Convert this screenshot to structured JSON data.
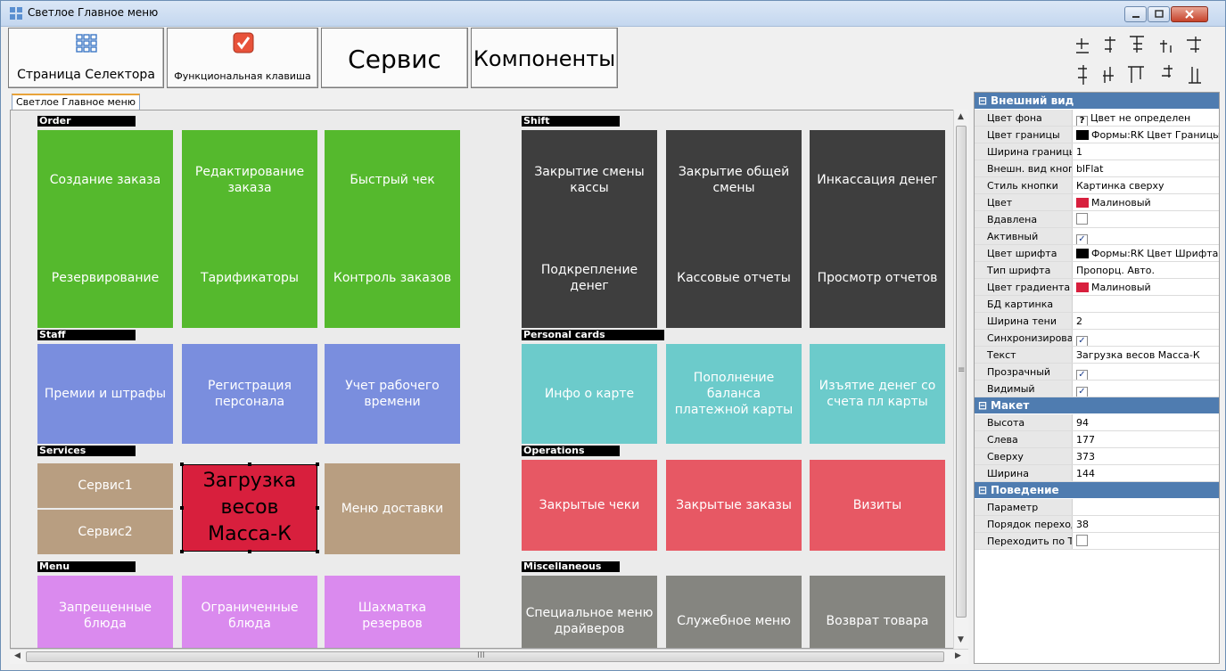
{
  "window": {
    "title": "Светлое Главное меню"
  },
  "toolbar": {
    "selector_page": "Страница Селектора",
    "function_key": "Функциональная клавиша",
    "service": "Сервис",
    "components": "Компоненты"
  },
  "align_tools": [
    "⊣ ⫞ ⊐ ⊥ ⊢",
    "⊤ ⫟ ⊏ ⊣ ⊥"
  ],
  "tab": {
    "label": "Светлое Главное меню"
  },
  "colors": {
    "green": "#55b92d",
    "dark": "#3e3e3e",
    "blue": "#7a8ede",
    "cyan": "#6ccbcb",
    "tan": "#b89e81",
    "crimson": "#d81f3d",
    "coral": "#e75864",
    "violet": "#da8aee",
    "gray": "#858580"
  },
  "groups": {
    "order": "Order",
    "shift": "Shift",
    "staff": "Staff",
    "personal_cards": "Personal cards",
    "services": "Services",
    "operations": "Operations",
    "menu": "Menu",
    "misc": "Miscellaneous"
  },
  "tiles": {
    "create_order": "Создание заказа",
    "edit_order": "Редактирование заказа",
    "fast_check": "Быстрый чек",
    "reservation": "Резервирование",
    "tariffs": "Тарификаторы",
    "order_control": "Контроль заказов",
    "close_cash_shift": "Закрытие смены кассы",
    "close_common_shift": "Закрытие общей смены",
    "cash_collection": "Инкассация денег",
    "cash_reinforce": "Подкрепление денег",
    "cash_reports": "Кассовые отчеты",
    "view_reports": "Просмотр отчетов",
    "bonuses": "Премии и штрафы",
    "staff_reg": "Регистрация персонала",
    "work_time": "Учет рабочего времени",
    "card_info": "Инфо о карте",
    "card_topup": "Пополнение баланса платежной карты",
    "card_withdraw": "Изъятие денег со счета пл карты",
    "service1": "Сервис1",
    "service2": "Сервис2",
    "scales": "Загрузка весов Масса-К",
    "delivery": "Меню доставки",
    "closed_checks": "Закрытые чеки",
    "closed_orders": "Закрытые заказы",
    "visits": "Визиты",
    "forbidden": "Запрещенные блюда",
    "limited": "Ограниченные блюда",
    "chess": "Шахматка резервов",
    "driver_menu": "Специальное меню драйверов",
    "service_menu": "Служебное меню",
    "return": "Возврат товара"
  },
  "scroll": {
    "h_thumb": "III",
    "v_thumb": "≡"
  },
  "props": {
    "appearance": "Внешний вид",
    "layout": "Макет",
    "behavior": "Поведение",
    "rows": {
      "bg_color_k": "Цвет фона",
      "bg_color_v": "Цвет не определен",
      "bg_q": "?",
      "border_color_k": "Цвет границы",
      "border_color_v": "Формы:RK Цвет Границы",
      "border_width_k": "Ширина границы",
      "border_width_v": "1",
      "btn_look_k": "Внешн. вид кнопки",
      "btn_look_v": "blFlat",
      "btn_style_k": "Стиль кнопки",
      "btn_style_v": "Картинка сверху",
      "color_k": "Цвет",
      "color_v": "Малиновый",
      "pressed_k": "Вдавлена",
      "active_k": "Активный",
      "font_color_k": "Цвет шрифта",
      "font_color_v": "Формы:RK Цвет Шрифта",
      "font_type_k": "Тип шрифта",
      "font_type_v": "Пропорц. Авто.",
      "grad_color_k": "Цвет градиента",
      "grad_color_v": "Малиновый",
      "db_pic_k": "БД картинка",
      "shadow_k": "Ширина тени",
      "shadow_v": "2",
      "sync_k": "Синхронизировать",
      "text_k": "Текст",
      "text_v": "Загрузка весов Масса-К",
      "transparent_k": "Прозрачный",
      "visible_k": "Видимый",
      "height_k": "Высота",
      "height_v": "94",
      "left_k": "Слева",
      "left_v": "177",
      "top_k": "Сверху",
      "top_v": "373",
      "width_k": "Ширина",
      "width_v": "144",
      "param_k": "Параметр",
      "taborder_k": "Порядок перехода",
      "taborder_v": "38",
      "tabstop_k": "Переходить по Tab"
    },
    "check": "✓"
  }
}
